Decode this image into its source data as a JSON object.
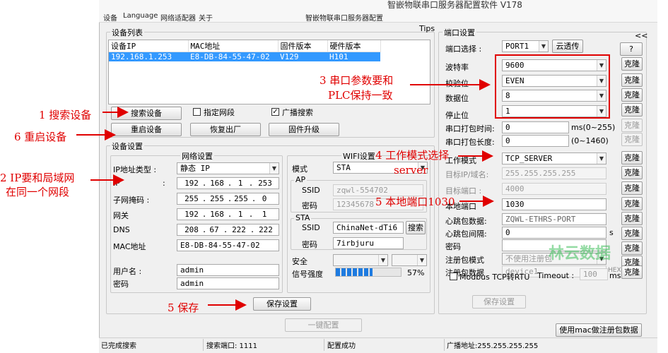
{
  "window": {
    "title": "智嵌物联串口服务器配置软件  V178"
  },
  "menu": {
    "items": [
      "设备",
      "Language",
      "网络适配器",
      "关于"
    ],
    "subtitle": "智嵌物联串口服务器配置"
  },
  "device_list": {
    "title": "设备列表",
    "tips": "Tips",
    "columns": [
      "设备IP",
      "MAC地址",
      "固件版本",
      "硬件版本"
    ],
    "rows": [
      [
        "192.168.1.253",
        "E8-DB-84-55-47-02",
        "V129",
        "H101"
      ]
    ]
  },
  "actions": {
    "search": "搜索设备",
    "restart": "重启设备",
    "factory": "恢复出厂",
    "upgrade": "固件升级",
    "specify_segment": "指定网段",
    "broadcast": "广播搜索"
  },
  "device_settings": {
    "title": "设备设置",
    "network": {
      "title": "网络设置",
      "ip_type_label": "IP地址类型 :",
      "ip_type_value": "静态 IP",
      "ip_label": "IP",
      "ip": [
        "192",
        "168",
        "1",
        "253"
      ],
      "mask_label": "子网掩码 :",
      "mask": [
        "255",
        "255",
        "255",
        "0"
      ],
      "gw_label": "网关",
      "gw": [
        "192",
        "168",
        "1",
        "1"
      ],
      "dns_label": "DNS",
      "dns": [
        "208",
        "67",
        "222",
        "222"
      ],
      "mac_label": "MAC地址",
      "mac": "E8-DB-84-55-47-02",
      "user_label": "用户名 :",
      "user": "admin",
      "pwd_label": "密码",
      "pwd": "admin",
      "save": "保存设置"
    },
    "wifi": {
      "title": "WIFI设置",
      "mode_label": "模式",
      "mode": "STA",
      "ap_title": "AP",
      "ap_ssid_label": "SSID",
      "ap_ssid": "zqwl-554702",
      "ap_pwd_label": "密码",
      "ap_pwd": "12345678",
      "sta_title": "STA",
      "sta_ssid_label": "SSID",
      "sta_ssid": "ChinaNet-dTi6",
      "sta_search": "搜索",
      "sta_pwd_label": "密码",
      "sta_pwd": "7irbjuru",
      "security_label": "安全",
      "signal_label": "信号强度",
      "signal_text": "57%",
      "signal_percent": 57
    }
  },
  "port_settings": {
    "title": "端口设置",
    "collapse": "<<",
    "port_select_label": "端口选择 :",
    "port": "PORT1",
    "cloud": "云透传",
    "help": "?",
    "baud_label": "波特率",
    "baud": "9600",
    "parity_label": "校验位",
    "parity": "EVEN",
    "databits_label": "数据位",
    "databits": "8",
    "stopbits_label": "停止位",
    "stopbits": "1",
    "pack_time_label": "串口打包时间:",
    "pack_time": "0",
    "pack_time_unit": "ms(0~255)",
    "pack_len_label": "串口打包长度:",
    "pack_len": "0",
    "pack_len_unit": "(0~1460)",
    "work_mode_label": "工作模式",
    "work_mode": "TCP_SERVER",
    "target_ip_label": "目标IP/域名:",
    "target_ip": "255.255.255.255",
    "target_port_label": "目标端口 :",
    "target_port": "4000",
    "local_port_label": "本地端口",
    "local_port": "1030",
    "heartbeat_label": "心跳包数据:",
    "heartbeat": "ZQWL-ETHRS-PORT",
    "heartbeat_interval_label": "心跳包间隔:",
    "heartbeat_interval": "0",
    "heartbeat_interval_unit": "s",
    "password_label": "密码",
    "reg_mode_label": "注册包模式",
    "reg_mode": "不使用注册包",
    "reg_data_label": "注册包数据",
    "reg_data": "device1",
    "reg_hex": "HEX",
    "modbus_label": "Modbus TCP转RTU",
    "timeout_label": "Timeout :",
    "timeout": "100",
    "timeout_unit": "ms",
    "clone": "克隆",
    "save": "保存设置",
    "mac_register": "使用mac做注册包数据"
  },
  "one_key": "一键配置",
  "statusbar": [
    "已完成搜索",
    "搜索端口: 1111",
    "配置成功",
    "广播地址:255.255.255.255"
  ],
  "annotations": {
    "a1": "1 搜索设备",
    "a6": "6 重启设备",
    "a2_line1": "2 IP要和局域网",
    "a2_line2": "在同一个网段",
    "a3_line1": "3 串口参数要和",
    "a3_line2": "PLC保持一致",
    "a4": "4 工作模式选择",
    "a4_line2": "server",
    "a5_port": "5 本地端口1030",
    "a5_save": "5 保存"
  },
  "watermark": "林云数据",
  "colors": {
    "annotation": "#e00000",
    "selection": "#3399ff",
    "signal": "#1e7be0"
  }
}
